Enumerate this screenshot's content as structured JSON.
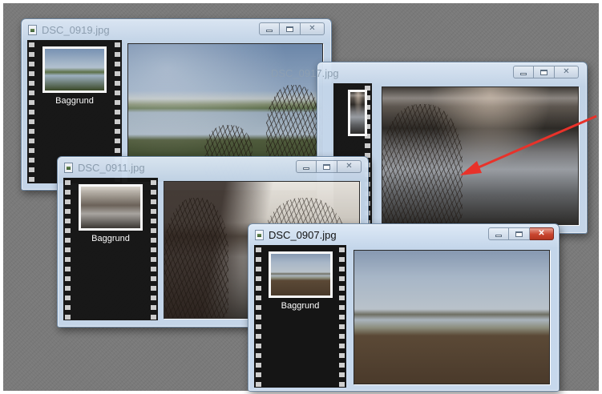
{
  "thumbnail_label": "Baggrund",
  "windows": [
    {
      "title": "DSC_0919.jpg",
      "active": false
    },
    {
      "title": "DSC_0917.jpg",
      "active": false
    },
    {
      "title": "DSC_0911.jpg",
      "active": false
    },
    {
      "title": "DSC_0907.jpg",
      "active": true
    }
  ],
  "icons": {
    "document": "image-file-icon",
    "minimize": "minimize-icon",
    "maximize": "maximize-icon",
    "close": "close-icon"
  },
  "close_glyph": "✕",
  "annotation": {
    "type": "arrow",
    "color": "#e8322a"
  }
}
